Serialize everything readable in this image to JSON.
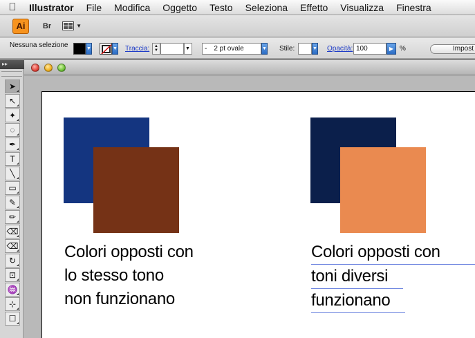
{
  "menubar": {
    "items": [
      "Illustrator",
      "File",
      "Modifica",
      "Oggetto",
      "Testo",
      "Seleziona",
      "Effetto",
      "Visualizza",
      "Finestra"
    ]
  },
  "appbar": {
    "logo": "Ai",
    "bridge": "Br"
  },
  "control": {
    "selection": "Nessuna selezione",
    "stroke_label": "Traccia:",
    "stroke_width": "",
    "brush": "2 pt ovale",
    "brush_dash": "-",
    "style_label": "Stile:",
    "opacity_label": "Opacità:",
    "opacity_value": "100",
    "percent": "%",
    "setup_label": "Impost",
    "fill_color": "#000000",
    "accent": "#2b6cc4"
  },
  "tools": {
    "items": [
      "➤",
      "↖",
      "✦",
      "◌",
      "✒",
      "T",
      "╲",
      "▭",
      "✎",
      "✏",
      "⌫",
      "⌫",
      "↻",
      "⊡",
      "♒",
      "⊹",
      "☐"
    ]
  },
  "artwork": {
    "left": {
      "back_color": "#143580",
      "front_color": "#753216",
      "caption": [
        "Colori opposti con",
        "lo stesso tono",
        "non funzionano"
      ]
    },
    "right": {
      "back_color": "#0b1f4b",
      "front_color": "#ea8a50",
      "caption": [
        "Colori opposti con",
        "toni diversi",
        "funzionano"
      ]
    }
  }
}
